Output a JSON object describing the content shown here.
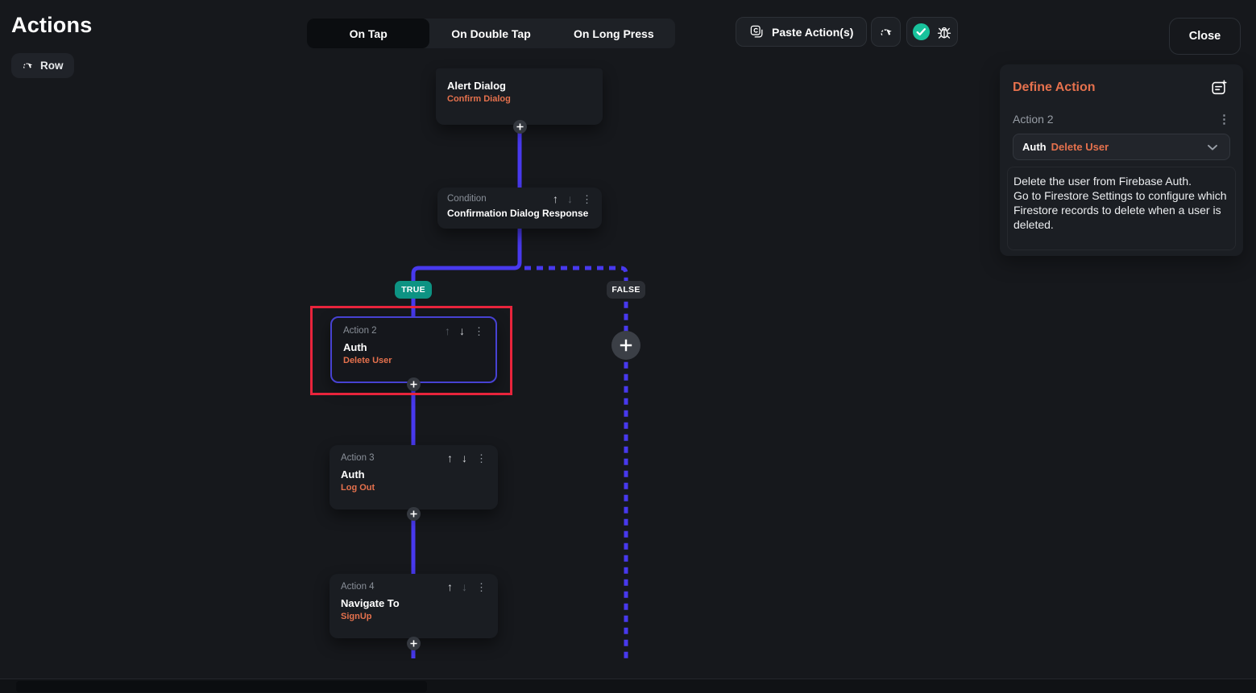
{
  "header": {
    "title": "Actions",
    "row_button_label": "Row",
    "tabs": [
      {
        "label": "On Tap",
        "selected": true
      },
      {
        "label": "On Double Tap",
        "selected": false
      },
      {
        "label": "On Long Press",
        "selected": false
      }
    ],
    "paste_button_label": "Paste Action(s)",
    "close_button_label": "Close"
  },
  "define_panel": {
    "title": "Define Action",
    "action_label": "Action 2",
    "action_type": "Auth",
    "action_value": "Delete User",
    "description": "Delete the user from Firebase Auth.\nGo to Firestore Settings to configure which Firestore records to delete when a user is deleted."
  },
  "flow": {
    "true_label": "TRUE",
    "false_label": "FALSE",
    "nodes": {
      "alert": {
        "title": "Alert Dialog",
        "subtitle": "Confirm Dialog"
      },
      "condition": {
        "label": "Condition",
        "title": "Confirmation Dialog Response"
      },
      "action2": {
        "label": "Action 2",
        "title": "Auth",
        "subtitle": "Delete User"
      },
      "action3": {
        "label": "Action 3",
        "title": "Auth",
        "subtitle": "Log Out"
      },
      "action4": {
        "label": "Action 4",
        "title": "Navigate To",
        "subtitle": "SignUp"
      }
    }
  },
  "icons": {
    "up_arrow": "↑",
    "down_arrow": "↓",
    "kebab": "⋮"
  },
  "colors": {
    "accent_purple": "#4839ee",
    "accent_orange": "#e5714d",
    "true_badge_teal": "#0d9383",
    "selection_red": "#e8243c",
    "check_teal": "#18c29c"
  }
}
